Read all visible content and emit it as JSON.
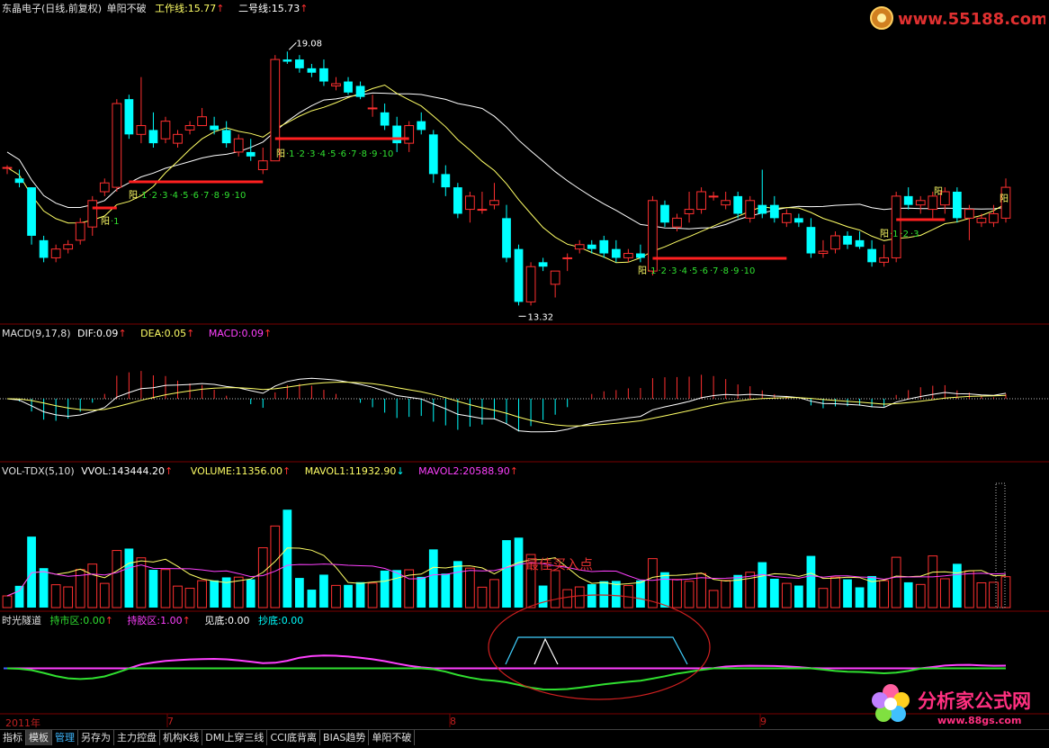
{
  "header": {
    "stock": "东晶电子(日线,前复权)",
    "indicator": "单阳不破",
    "work_line": "工作线:15.77",
    "line_two": "二号线:15.73",
    "up_arrow": "↑",
    "down_arrow": "↓"
  },
  "watermark_top": "www.55188.com",
  "watermark_bottom": "分析家公式网",
  "watermark_bottom_url": "www.88gs.com",
  "macd_header": {
    "name": "MACD(9,17,8)",
    "dif": "DIF:0.09",
    "dea": "DEA:0.05",
    "macd": "MACD:0.09"
  },
  "vol_header": {
    "name": "VOL-TDX(5,10)",
    "vvol": "VVOL:143444.20",
    "volume": "VOLUME:11356.00",
    "mavol1": "MAVOL1:11932.90",
    "mavol2": "MAVOL2:20588.90"
  },
  "tunnel_header": {
    "name": "时光隧道",
    "hold_market": "持市区:0.00",
    "hold_coin": "持胶区:1.00",
    "see_bottom": "见底:0.00",
    "copy_bottom": "抄底:0.00"
  },
  "annotation": "最佳买入点",
  "price_high_label": "19.08",
  "price_low_label": "13.32",
  "date_axis": [
    "2011年",
    "7",
    "8",
    "9"
  ],
  "tabs": [
    "指标",
    "模板",
    "管理",
    "另存为",
    "主力控盘",
    "机构K线",
    "DMI上穿三线",
    "CCI底背离",
    "BIAS趋势",
    "单阳不破"
  ],
  "count_labels": {
    "yang": "阳",
    "seq_a": [
      "1"
    ],
    "seq_b": [
      "1",
      "2",
      "3",
      "4",
      "5",
      "6",
      "7",
      "8",
      "9",
      "10"
    ],
    "seq_c": [
      "1",
      "2",
      "3",
      "4",
      "5",
      "6",
      "7",
      "8",
      "9",
      "10"
    ],
    "seq_d": [
      "1",
      "2",
      "3",
      "4",
      "5",
      "6",
      "7",
      "8",
      "9",
      "10"
    ],
    "seq_e": [
      "1",
      "2",
      "3"
    ]
  },
  "colors": {
    "up": "#ff3030",
    "down": "#00ffff",
    "ma_white": "#ffffff",
    "ma_yellow": "#ffff66",
    "magenta": "#ff40ff",
    "green": "#30e030",
    "blue": "#4060ff",
    "red_line": "#ff2020"
  },
  "chart_data": {
    "type": "candlestick",
    "ohlc": [
      [
        16.45,
        16.5,
        16.3,
        16.45
      ],
      [
        16.2,
        16.4,
        16.0,
        16.1
      ],
      [
        16.0,
        16.0,
        14.7,
        14.9
      ],
      [
        14.8,
        14.9,
        14.3,
        14.4
      ],
      [
        14.4,
        14.7,
        14.3,
        14.6
      ],
      [
        14.6,
        14.8,
        14.5,
        14.7
      ],
      [
        14.8,
        15.3,
        14.7,
        15.2
      ],
      [
        15.1,
        15.8,
        14.9,
        15.7
      ],
      [
        15.9,
        16.2,
        15.8,
        16.1
      ],
      [
        16.0,
        18.0,
        15.9,
        17.9
      ],
      [
        18.0,
        18.1,
        17.1,
        17.2
      ],
      [
        17.2,
        18.5,
        17.0,
        17.4
      ],
      [
        17.3,
        17.7,
        16.9,
        17.0
      ],
      [
        17.1,
        17.6,
        17.0,
        17.5
      ],
      [
        17.0,
        17.3,
        16.9,
        17.2
      ],
      [
        17.3,
        17.5,
        17.2,
        17.4
      ],
      [
        17.4,
        17.8,
        17.4,
        17.6
      ],
      [
        17.4,
        17.6,
        17.2,
        17.3
      ],
      [
        17.3,
        17.5,
        16.9,
        17.0
      ],
      [
        16.8,
        17.2,
        16.7,
        17.1
      ],
      [
        16.8,
        17.1,
        16.6,
        16.7
      ],
      [
        16.4,
        16.9,
        16.3,
        16.6
      ],
      [
        16.6,
        19.0,
        16.6,
        18.9
      ],
      [
        18.9,
        19.08,
        18.8,
        18.85
      ],
      [
        18.9,
        19.0,
        18.6,
        18.7
      ],
      [
        18.7,
        18.8,
        18.5,
        18.6
      ],
      [
        18.7,
        18.9,
        18.3,
        18.4
      ],
      [
        18.3,
        18.5,
        18.2,
        18.35
      ],
      [
        18.4,
        18.5,
        18.1,
        18.15
      ],
      [
        18.3,
        18.4,
        18.0,
        18.05
      ],
      [
        17.8,
        18.1,
        17.6,
        17.8
      ],
      [
        17.7,
        17.9,
        17.3,
        17.4
      ],
      [
        17.4,
        17.6,
        16.8,
        17.0
      ],
      [
        17.0,
        17.5,
        16.8,
        17.4
      ],
      [
        17.5,
        17.7,
        17.2,
        17.3
      ],
      [
        17.2,
        17.3,
        16.1,
        16.3
      ],
      [
        16.3,
        16.5,
        15.8,
        16.0
      ],
      [
        16.0,
        16.1,
        15.3,
        15.4
      ],
      [
        15.5,
        15.9,
        15.2,
        15.8
      ],
      [
        15.5,
        15.9,
        15.4,
        15.5
      ],
      [
        15.6,
        16.1,
        15.5,
        15.7
      ],
      [
        15.3,
        15.6,
        14.3,
        14.4
      ],
      [
        14.6,
        14.7,
        13.32,
        13.4
      ],
      [
        13.4,
        14.3,
        13.32,
        14.2
      ],
      [
        14.3,
        14.4,
        14.1,
        14.2
      ],
      [
        13.8,
        14.1,
        13.5,
        14.1
      ],
      [
        14.4,
        14.5,
        14.1,
        14.4
      ],
      [
        14.6,
        14.8,
        14.5,
        14.7
      ],
      [
        14.7,
        14.8,
        14.5,
        14.6
      ],
      [
        14.8,
        14.9,
        14.4,
        14.5
      ],
      [
        14.6,
        14.8,
        14.3,
        14.4
      ],
      [
        14.4,
        14.6,
        14.3,
        14.5
      ],
      [
        14.5,
        14.7,
        14.3,
        14.4
      ],
      [
        14.1,
        15.8,
        14.0,
        15.7
      ],
      [
        15.6,
        15.7,
        15.1,
        15.2
      ],
      [
        15.1,
        15.4,
        15.0,
        15.3
      ],
      [
        15.4,
        15.9,
        15.2,
        15.5
      ],
      [
        15.5,
        16.0,
        15.4,
        15.9
      ],
      [
        15.8,
        15.9,
        15.7,
        15.8
      ],
      [
        15.6,
        15.9,
        15.5,
        15.7
      ],
      [
        15.8,
        15.9,
        15.3,
        15.4
      ],
      [
        15.3,
        15.8,
        15.2,
        15.7
      ],
      [
        15.6,
        16.4,
        15.3,
        15.4
      ],
      [
        15.6,
        15.8,
        15.2,
        15.3
      ],
      [
        15.2,
        15.5,
        15.1,
        15.4
      ],
      [
        15.3,
        15.4,
        15.1,
        15.2
      ],
      [
        15.1,
        15.3,
        14.4,
        14.5
      ],
      [
        14.5,
        14.8,
        14.4,
        14.55
      ],
      [
        14.6,
        15.0,
        14.5,
        14.9
      ],
      [
        14.9,
        15.0,
        14.6,
        14.7
      ],
      [
        14.8,
        15.0,
        14.6,
        14.65
      ],
      [
        14.6,
        14.8,
        14.2,
        14.3
      ],
      [
        14.3,
        14.7,
        14.2,
        14.4
      ],
      [
        14.4,
        15.9,
        14.3,
        15.8
      ],
      [
        15.8,
        16.0,
        15.5,
        15.6
      ],
      [
        15.6,
        15.8,
        15.4,
        15.7
      ],
      [
        15.5,
        15.9,
        15.3,
        15.8
      ],
      [
        15.6,
        16.0,
        15.4,
        15.9
      ],
      [
        15.9,
        16.0,
        15.2,
        15.3
      ],
      [
        15.3,
        15.6,
        14.8,
        15.5
      ],
      [
        15.2,
        15.4,
        15.1,
        15.3
      ],
      [
        15.2,
        15.6,
        15.1,
        15.4
      ],
      [
        15.3,
        16.2,
        15.2,
        16.0
      ]
    ],
    "ylim": [
      13.0,
      19.8
    ],
    "macd_ylim": [
      -0.55,
      0.55
    ],
    "vol_ylim": [
      0,
      48000
    ],
    "tunnel_ylim": [
      -2,
      2
    ]
  }
}
